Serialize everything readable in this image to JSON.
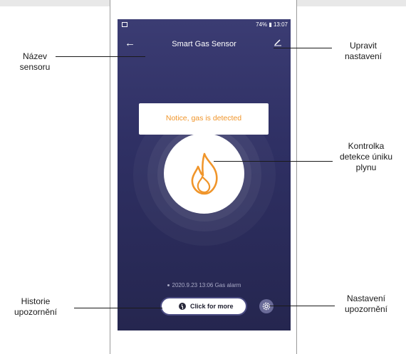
{
  "phone": {
    "status_time": "74% ▮ 13:07",
    "title": "Smart Gas Sensor",
    "back_glyph": "←",
    "edit_glyph": "∕",
    "alert_text": "Notice, gas is detected",
    "history_entry": "2020.9.23 13:06 Gas alarm",
    "more_button": "Click for more",
    "accent_color": "#f0952a",
    "icons": [
      "back-arrow-icon",
      "edit-pencil-icon",
      "flame-icon",
      "clock-icon",
      "settings-gear-icon"
    ]
  },
  "annotations": {
    "sensor_name": "Název\nsensoru",
    "edit_settings": "Upravit\nnastavení",
    "leak_indicator": "Kontrolka\ndetekce úniku\nplynu",
    "alert_history": "Historie\nupozornění",
    "alert_settings": "Nastavení\nupozornění"
  }
}
